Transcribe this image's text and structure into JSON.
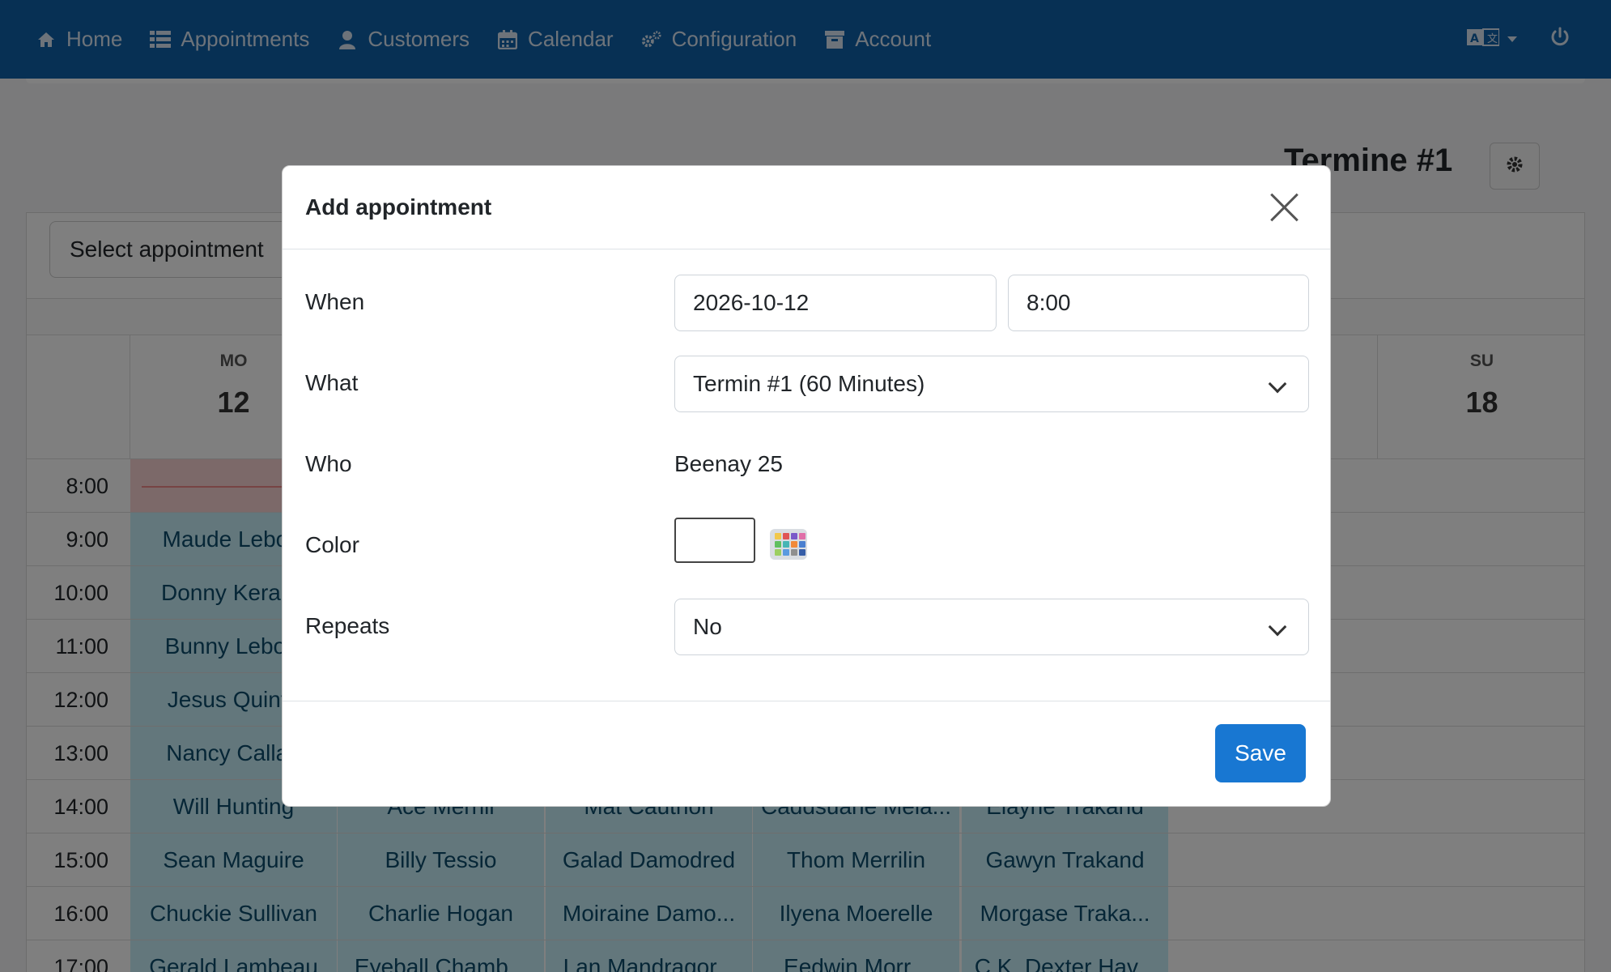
{
  "nav": {
    "items": [
      {
        "label": "Home",
        "icon": "home-icon"
      },
      {
        "label": "Appointments",
        "icon": "list-icon"
      },
      {
        "label": "Customers",
        "icon": "user-icon"
      },
      {
        "label": "Calendar",
        "icon": "calendar-icon"
      },
      {
        "label": "Configuration",
        "icon": "cogs-icon"
      },
      {
        "label": "Account",
        "icon": "archive-icon"
      }
    ],
    "language_icon": "language-icon",
    "power_icon": "power-icon"
  },
  "page": {
    "title": "Termine #1",
    "select_label": "Select appointment"
  },
  "calendar": {
    "days": [
      {
        "dow": "MO",
        "num": "12"
      },
      {
        "dow": "SU",
        "num": "18"
      }
    ],
    "times": [
      "8:00",
      "9:00",
      "10:00",
      "11:00",
      "12:00",
      "13:00",
      "14:00",
      "15:00",
      "16:00",
      "17:00"
    ],
    "rows": [
      [
        "",
        "",
        "",
        "",
        ""
      ],
      [
        "Maude Lebow",
        "",
        "",
        "",
        ""
      ],
      [
        "Donny Keraba",
        "",
        "",
        "",
        ""
      ],
      [
        "Bunny Lebow",
        "",
        "",
        "",
        ""
      ],
      [
        "Jesus Quinta",
        "",
        "",
        "",
        ""
      ],
      [
        "Nancy Callah",
        "",
        "",
        "",
        ""
      ],
      [
        "Will Hunting",
        "Ace Merrill",
        "Mat Cauthon",
        "Caddsuane Mela...",
        "Elayne Trakand"
      ],
      [
        "Sean Maguire",
        "Billy Tessio",
        "Galad Damodred",
        "Thom Merrilin",
        "Gawyn Trakand"
      ],
      [
        "Chuckie Sullivan",
        "Charlie Hogan",
        "Moiraine Damo...",
        "Ilyena Moerelle",
        "Morgase Traka..."
      ],
      [
        "Gerald Lambeau",
        "Eyeball Chamb...",
        "Lan Mandragor...",
        "Eedwin Morr...",
        "C.K. Dexter Hav..."
      ]
    ]
  },
  "modal": {
    "title": "Add appointment",
    "when_label": "When",
    "date_value": "2026-10-12",
    "time_value": "8:00",
    "what_label": "What",
    "what_value": "Termin #1 (60 Minutes)",
    "who_label": "Who",
    "who_value": "Beenay 25",
    "color_label": "Color",
    "color_value": "#ffffff",
    "repeats_label": "Repeats",
    "repeats_value": "No",
    "save_label": "Save"
  },
  "colors": {
    "navbar": "#0f61a8",
    "primary": "#1877d2",
    "event": "#c6eef9",
    "event_red": "#f9d2d2"
  }
}
